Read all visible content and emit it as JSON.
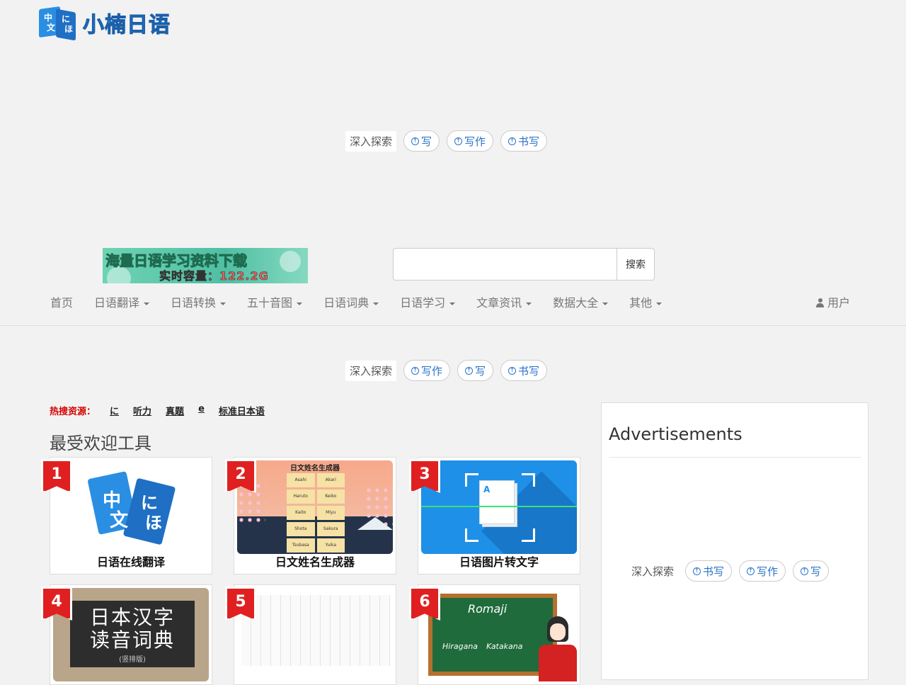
{
  "logo": {
    "mark_chars": [
      "中",
      "文",
      "に",
      "ほ"
    ],
    "text": "小楠日语"
  },
  "explore_top": {
    "label": "深入探索",
    "chips": [
      "写",
      "写作",
      "书写"
    ]
  },
  "banner": {
    "line1": "海量日语学习资料下载",
    "line2_prefix": "实时容量：",
    "line2_value": "122.2G"
  },
  "search": {
    "value": "",
    "placeholder": "",
    "button": "搜索"
  },
  "nav": {
    "items": [
      {
        "label": "首页",
        "dropdown": false
      },
      {
        "label": "日语翻译",
        "dropdown": true
      },
      {
        "label": "日语转换",
        "dropdown": true
      },
      {
        "label": "五十音图",
        "dropdown": true
      },
      {
        "label": "日语词典",
        "dropdown": true
      },
      {
        "label": "日语学习",
        "dropdown": true
      },
      {
        "label": "文章资讯",
        "dropdown": true
      },
      {
        "label": "数据大全",
        "dropdown": true
      },
      {
        "label": "其他",
        "dropdown": true
      }
    ],
    "user": "用户"
  },
  "explore_mid": {
    "label": "深入探索",
    "chips": [
      "写作",
      "写",
      "书写"
    ]
  },
  "hot": {
    "label": "热搜资源：",
    "links": [
      "に",
      "听力",
      "真题",
      "e",
      "标准日本语"
    ]
  },
  "section_title": "最受欢迎工具",
  "tools": [
    {
      "rank": "1",
      "label": "日语在线翻译"
    },
    {
      "rank": "2",
      "label": "日文姓名生成器",
      "thumb_title": "日文姓名生成器",
      "names": [
        "Asahi",
        "Akari",
        "Haruto",
        "Keiko",
        "Kaito",
        "Miyu",
        "Shota",
        "Sakura",
        "Tsubasa",
        "Yuika"
      ]
    },
    {
      "rank": "3",
      "label": "日语图片转文字",
      "thumb_letter": "A"
    },
    {
      "rank": "4",
      "label": "",
      "thumb_line1": "日本汉字",
      "thumb_line2": "读音词典",
      "thumb_line3": "(竖排版)"
    },
    {
      "rank": "5",
      "label": ""
    },
    {
      "rank": "6",
      "label": "",
      "thumb_title": "Romaji",
      "thumb_left": "Hiragana",
      "thumb_right": "Katakana"
    }
  ],
  "sidebar": {
    "title": "Advertisements",
    "explore_label": "深入探索",
    "chips": [
      "书写",
      "写作",
      "写"
    ]
  },
  "colors": {
    "accent": "#2a72c8",
    "badge_red": "#e02020",
    "hot_label": "#d40000"
  }
}
